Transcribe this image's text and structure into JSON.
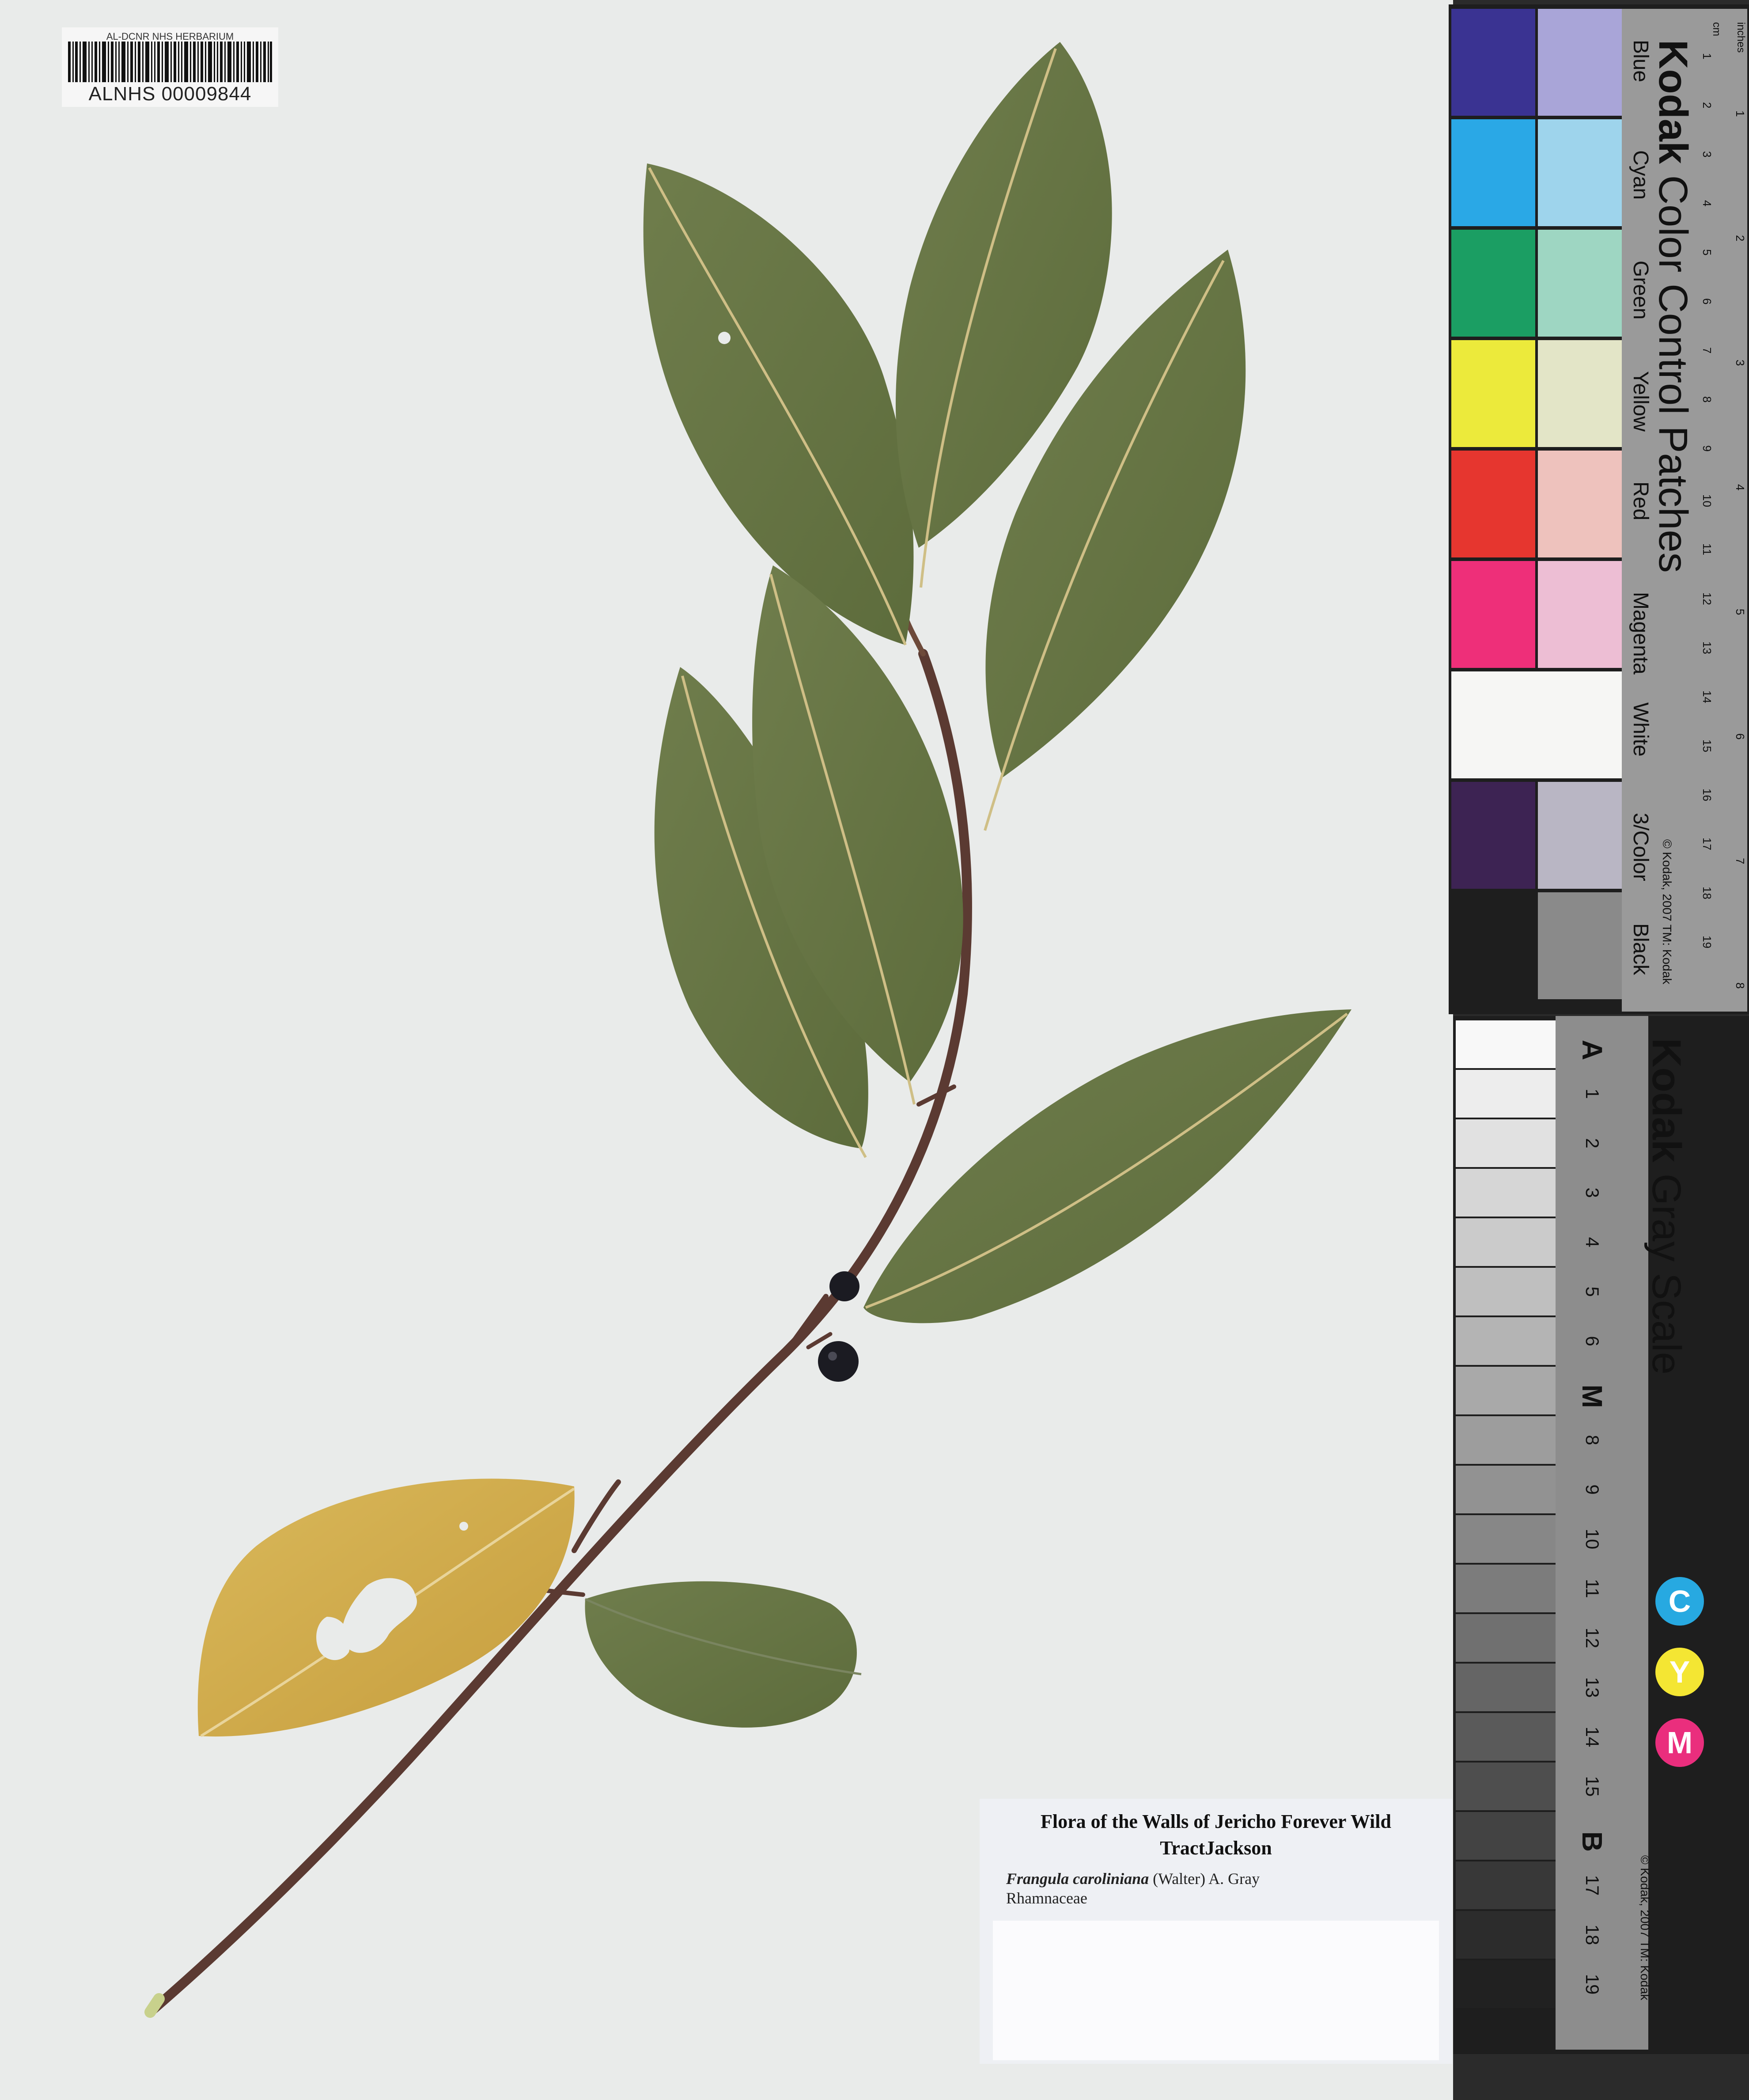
{
  "barcode": {
    "header": "AL-DCNR NHS HERBARIUM",
    "number": "ALNHS 00009844"
  },
  "label": {
    "title_line1": "Flora of the Walls of Jericho Forever Wild",
    "title_line2": "TractJackson",
    "scientific_name": "Frangula caroliniana",
    "authority": "(Walter) A. Gray",
    "family": "Rhamnaceae"
  },
  "color_card": {
    "brand": "Kodak",
    "title": "Color Control Patches",
    "patch_names": [
      "Blue",
      "Cyan",
      "Green",
      "Yellow",
      "Red",
      "Magenta",
      "White",
      "3/Color",
      "Black"
    ],
    "patch_colors_left": [
      "#3a3392",
      "#2aa8e6",
      "#1b9e63",
      "#ecea3b",
      "#e6362f",
      "#ee2f79",
      "#f6f6f4",
      "#3d2353",
      "#1e1e1e"
    ],
    "patch_colors_right": [
      "#a9a5d8",
      "#9ed4ec",
      "#9ed6c2",
      "#e3e5c7",
      "#eec2bd",
      "#edbed4",
      "#f6f6f4",
      "#b9b6c4",
      "#8a8a8a"
    ],
    "copyright": "© Kodak, 2007 TM: Kodak",
    "ruler_cm": [
      "1",
      "2",
      "3",
      "4",
      "5",
      "6",
      "7",
      "8",
      "9",
      "10",
      "11",
      "12",
      "13",
      "14",
      "15",
      "16",
      "17",
      "18",
      "19"
    ],
    "ruler_inch": [
      "1",
      "2",
      "3",
      "4",
      "5",
      "6",
      "7",
      "8"
    ],
    "unit_cm": "cm",
    "unit_in": "inches"
  },
  "gray_card": {
    "brand": "Kodak",
    "title": "Gray Scale",
    "steps": [
      "A",
      "1",
      "2",
      "3",
      "4",
      "5",
      "6",
      "M",
      "8",
      "9",
      "10",
      "11",
      "12",
      "13",
      "14",
      "15",
      "B",
      "17",
      "18",
      "19"
    ],
    "copyright": "© Kodak, 2007 TM: Kodak",
    "cym_letters": [
      "C",
      "Y",
      "M"
    ],
    "cym_colors": [
      "#27a9e1",
      "#f4e633",
      "#ea2e7d"
    ]
  }
}
